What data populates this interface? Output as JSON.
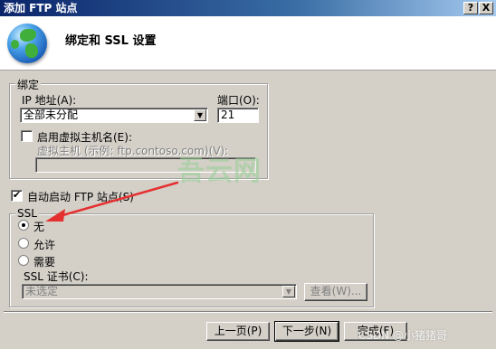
{
  "window": {
    "title": "添加 FTP 站点",
    "help_btn": "?",
    "close_btn": "X"
  },
  "header": {
    "title": "绑定和 SSL 设置",
    "icon": "globe-icon"
  },
  "binding": {
    "group_label": "绑定",
    "ip_label": "IP 地址(A):",
    "ip_value": "全部未分配",
    "port_label": "端口(O):",
    "port_value": "21",
    "vhost_checkbox_label": "启用虚拟主机名(E):",
    "vhost_checked": false,
    "vhost_field_label": "虚拟主机 (示例: ftp.contoso.com)(V):",
    "vhost_value": ""
  },
  "autostart": {
    "label": "自动启动 FTP 站点(S)",
    "checked": true
  },
  "ssl": {
    "group_label": "SSL",
    "options": [
      {
        "label": "无",
        "checked": true
      },
      {
        "label": "允许",
        "checked": false
      },
      {
        "label": "需要",
        "checked": false
      }
    ],
    "cert_label": "SSL 证书(C):",
    "cert_value": "未选定",
    "view_button": "查看(W)..."
  },
  "footer": {
    "prev_button": "上一页(P)",
    "next_button": "下一步(N)",
    "finish_button": "完成(F)"
  },
  "watermarks": {
    "center": "吾云网",
    "corner": "CSDN @小猪猪哥"
  },
  "colors": {
    "arrow": "#e53030",
    "window_bg": "#d4d0c8"
  }
}
